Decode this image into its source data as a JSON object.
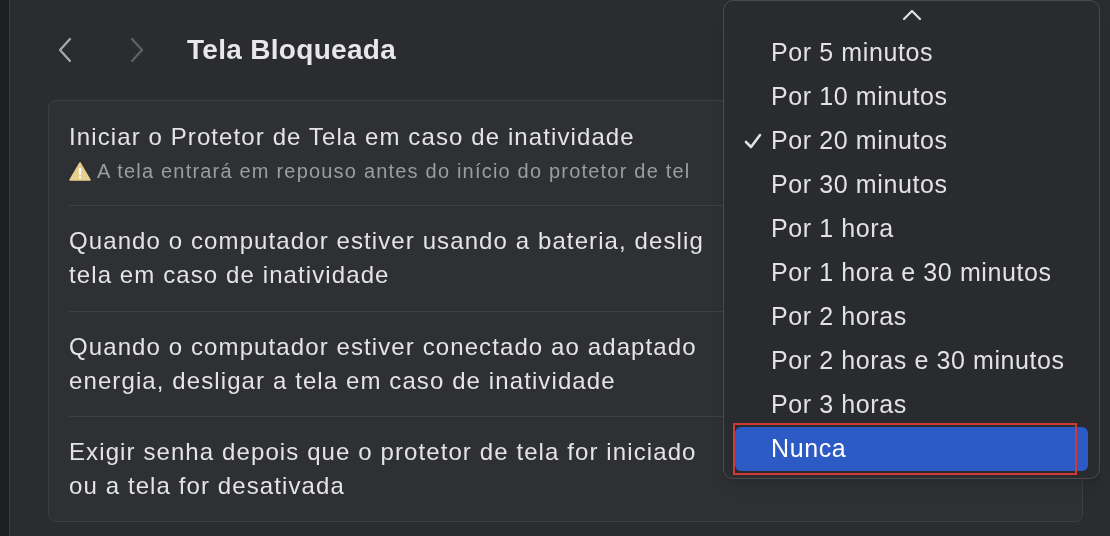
{
  "header": {
    "back_enabled": true,
    "forward_enabled": false,
    "title": "Tela Bloqueada"
  },
  "settings": [
    {
      "lines": [
        "Iniciar o Protetor de Tela em caso de inatividade"
      ],
      "warning": "A tela entrará em repouso antes do início do protetor de tel"
    },
    {
      "lines": [
        "Quando o computador estiver usando a bateria, deslig",
        "tela em caso de inatividade"
      ]
    },
    {
      "lines": [
        "Quando o computador estiver conectado ao adaptado",
        "energia, desligar a tela em caso de inatividade"
      ]
    },
    {
      "lines": [
        "Exigir senha depois que o protetor de tela for iniciado",
        "ou a tela for desativada"
      ]
    }
  ],
  "menu": {
    "scroll_up": true,
    "items": [
      {
        "label": "Por 5 minutos",
        "checked": false,
        "highlighted": false,
        "outlined": false
      },
      {
        "label": "Por 10 minutos",
        "checked": false,
        "highlighted": false,
        "outlined": false
      },
      {
        "label": "Por 20 minutos",
        "checked": true,
        "highlighted": false,
        "outlined": false
      },
      {
        "label": "Por 30 minutos",
        "checked": false,
        "highlighted": false,
        "outlined": false
      },
      {
        "label": "Por 1 hora",
        "checked": false,
        "highlighted": false,
        "outlined": false
      },
      {
        "label": "Por 1 hora e 30 minutos",
        "checked": false,
        "highlighted": false,
        "outlined": false
      },
      {
        "label": "Por 2 horas",
        "checked": false,
        "highlighted": false,
        "outlined": false
      },
      {
        "label": "Por 2 horas e 30 minutos",
        "checked": false,
        "highlighted": false,
        "outlined": false
      },
      {
        "label": "Por 3 horas",
        "checked": false,
        "highlighted": false,
        "outlined": false
      },
      {
        "label": "Nunca",
        "checked": false,
        "highlighted": true,
        "outlined": true
      }
    ]
  }
}
